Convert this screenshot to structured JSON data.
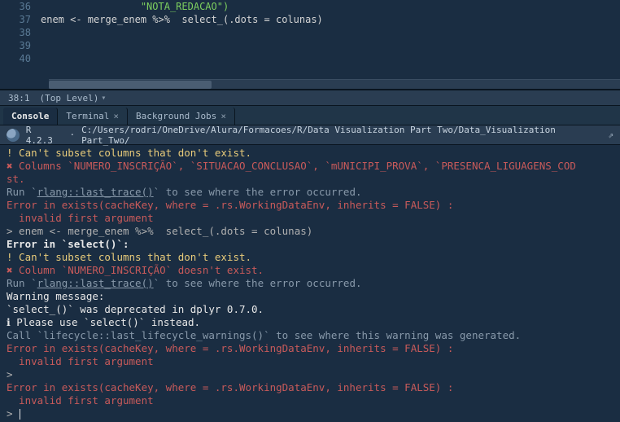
{
  "editor": {
    "lines": [
      {
        "num": "36",
        "class": "str",
        "text": "                 \"NOTA_REDACAO\")"
      },
      {
        "num": "37",
        "class": "norm",
        "text": "enem <- merge_enem %>%  select_(.dots = colunas)"
      },
      {
        "num": "38",
        "class": "norm",
        "text": ""
      },
      {
        "num": "39",
        "class": "norm",
        "text": ""
      },
      {
        "num": "40",
        "class": "norm",
        "text": ""
      }
    ]
  },
  "status": {
    "pos": "38:1",
    "scope": "(Top Level)"
  },
  "tabs": [
    {
      "label": "Console",
      "active": true,
      "closable": false
    },
    {
      "label": "Terminal",
      "active": false,
      "closable": true
    },
    {
      "label": "Background Jobs",
      "active": false,
      "closable": true
    }
  ],
  "info": {
    "r_version": "R 4.2.3",
    "path": "C:/Users/rodri/OneDrive/Alura/Formacoes/R/Data Visualization Part Two/Data_Visualization Part_Two/"
  },
  "console": [
    {
      "cls": "c-warn",
      "txt": "! Can't subset columns that don't exist."
    },
    {
      "cls": "c-err",
      "txt": "✖ Columns `NUMERO_INSCRIÇÃO`, `SITUACAO_CONCLUSAO`, `mUNICIPI_PROVA`, `PRESENCA_LIGUAGENS_COD"
    },
    {
      "cls": "c-err",
      "txt": "st."
    },
    {
      "cls": "c-note",
      "txt": "Run `rlang::last_trace()` to see where the error occurred.",
      "under": true,
      "under_part": "rlang::last_trace()"
    },
    {
      "cls": "c-err",
      "txt": "Error in exists(cacheKey, where = .rs.WorkingDataEnv, inherits = FALSE) :"
    },
    {
      "cls": "c-err",
      "txt": "  invalid first argument"
    },
    {
      "cls": "c-input",
      "txt": "> enem <- merge_enem %>%  select_(.dots = colunas)"
    },
    {
      "cls": "c-white",
      "txt": "Error in `select()`:",
      "bold": true
    },
    {
      "cls": "c-warn",
      "txt": "! Can't subset columns that don't exist."
    },
    {
      "cls": "c-err",
      "txt": "✖ Column `NUMERO_INSCRIÇÃO` doesn't exist."
    },
    {
      "cls": "c-note",
      "txt": "Run `rlang::last_trace()` to see where the error occurred.",
      "under": true,
      "under_part": "rlang::last_trace()"
    },
    {
      "cls": "c-white",
      "txt": "Warning message:"
    },
    {
      "cls": "c-white",
      "txt": "`select_()` was deprecated in dplyr 0.7.0."
    },
    {
      "cls": "c-white",
      "txt": "ℹ Please use `select()` instead."
    },
    {
      "cls": "c-note",
      "txt": "Call `lifecycle::last_lifecycle_warnings()` to see where this warning was generated."
    },
    {
      "cls": "c-err",
      "txt": "Error in exists(cacheKey, where = .rs.WorkingDataEnv, inherits = FALSE) :"
    },
    {
      "cls": "c-err",
      "txt": "  invalid first argument"
    },
    {
      "cls": "c-prompt",
      "txt": ">"
    },
    {
      "cls": "c-err",
      "txt": "Error in exists(cacheKey, where = .rs.WorkingDataEnv, inherits = FALSE) :"
    },
    {
      "cls": "c-err",
      "txt": "  invalid first argument"
    },
    {
      "cls": "c-prompt",
      "txt": "> ",
      "cursor": true
    }
  ]
}
